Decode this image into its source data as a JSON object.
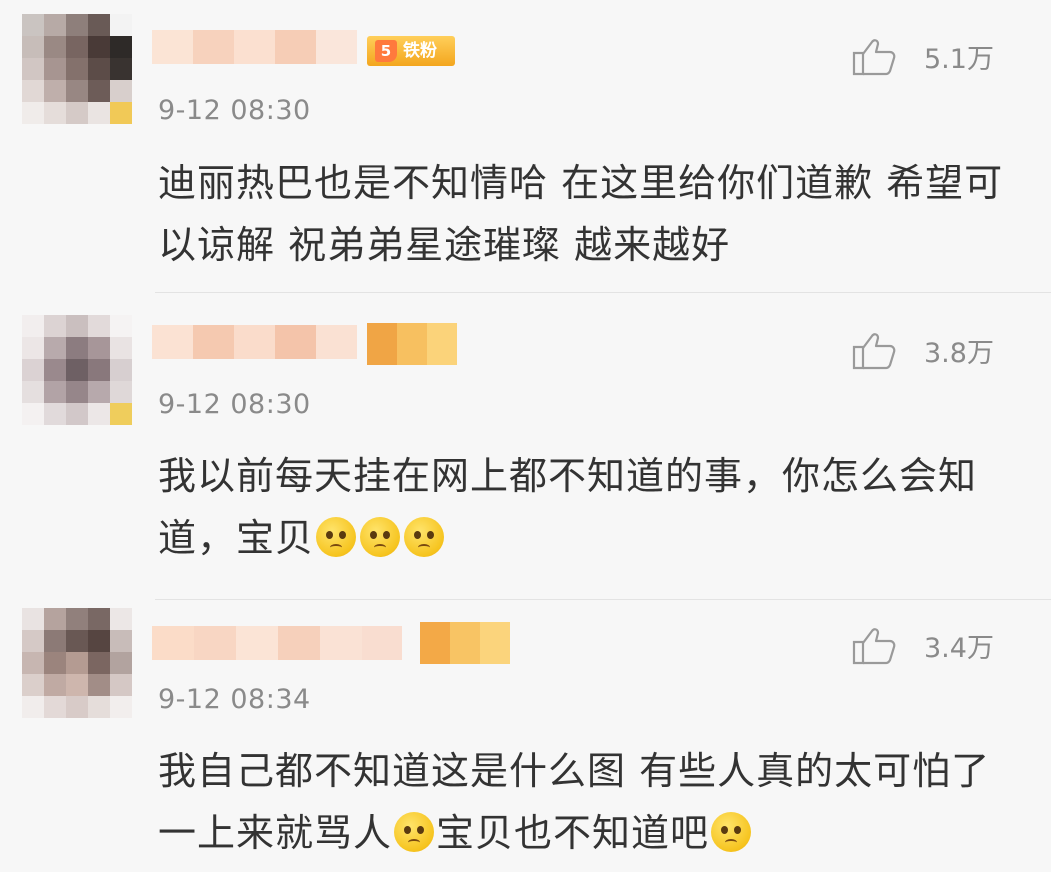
{
  "comments": [
    {
      "timestamp": "9-12 08:30",
      "likes": "5.1万",
      "badge": "铁粉",
      "text": "迪丽热巴也是不知情哈 在这里给你们道歉 希望可以谅解 祝弟弟星途璀璨 越来越好",
      "emoji_count": 0
    },
    {
      "timestamp": "9-12 08:30",
      "likes": "3.8万",
      "text": "我以前每天挂在网上都不知道的事，你怎么会知道，宝贝",
      "emoji_count": 3
    },
    {
      "timestamp": "9-12 08:34",
      "likes": "3.4万",
      "text_part1": "我自己都不知道这是什么图 有些人真的太可怕了 一上来就骂人",
      "text_part2": "宝贝也不知道吧",
      "emoji_count": 2
    }
  ],
  "icons": {
    "like": "thumbs-up-icon",
    "emoji": "pleading-face-emoji-icon",
    "badge": "fan-level-icon"
  },
  "colors": {
    "background": "#f7f7f7",
    "text": "#333333",
    "meta": "#8a8a8a",
    "badge": "#f3a61e"
  }
}
